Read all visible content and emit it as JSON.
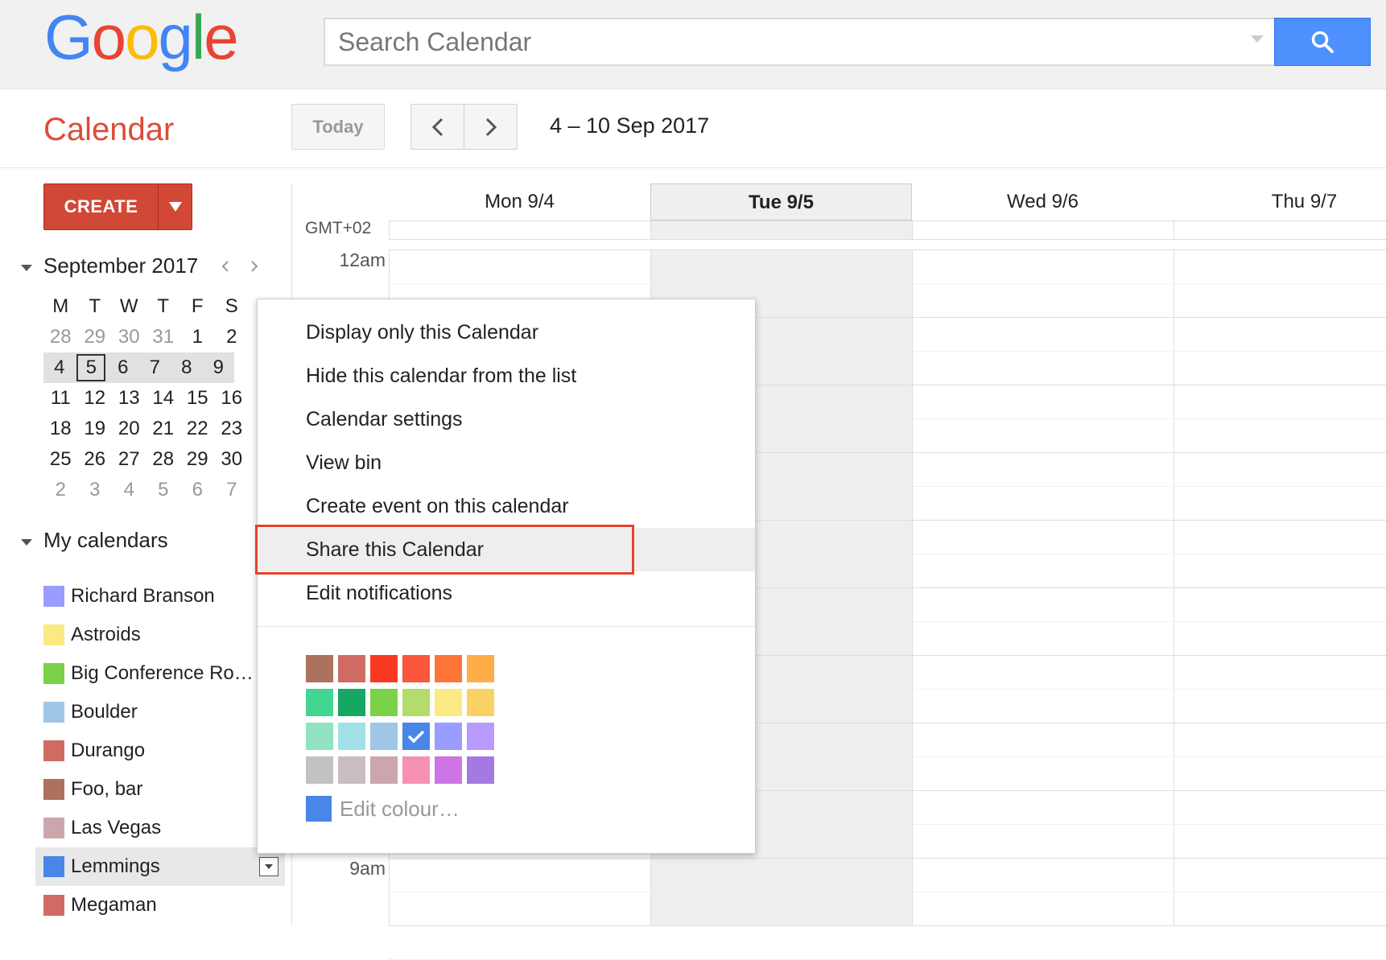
{
  "header": {
    "logo_letters": [
      {
        "ch": "G",
        "color": "#4285F4"
      },
      {
        "ch": "o",
        "color": "#EA4335"
      },
      {
        "ch": "o",
        "color": "#FBBC05"
      },
      {
        "ch": "g",
        "color": "#4285F4"
      },
      {
        "ch": "l",
        "color": "#34A853"
      },
      {
        "ch": "e",
        "color": "#EA4335"
      }
    ],
    "search_placeholder": "Search Calendar",
    "search_icon": "search-icon"
  },
  "toolbar": {
    "app_title": "Calendar",
    "today_label": "Today",
    "prev_icon": "chevron-left-icon",
    "next_icon": "chevron-right-icon",
    "date_range": "4 – 10 Sep 2017"
  },
  "sidebar": {
    "create_label": "CREATE",
    "mini_month": "September 2017",
    "weekday_heads": [
      "M",
      "T",
      "W",
      "T",
      "F",
      "S"
    ],
    "weeks": [
      [
        {
          "d": "28",
          "o": true
        },
        {
          "d": "29",
          "o": true
        },
        {
          "d": "30",
          "o": true
        },
        {
          "d": "31",
          "o": true
        },
        {
          "d": "1"
        },
        {
          "d": "2"
        }
      ],
      [
        {
          "d": "4"
        },
        {
          "d": "5",
          "today": true
        },
        {
          "d": "6"
        },
        {
          "d": "7"
        },
        {
          "d": "8"
        },
        {
          "d": "9"
        }
      ],
      [
        {
          "d": "11"
        },
        {
          "d": "12"
        },
        {
          "d": "13"
        },
        {
          "d": "14"
        },
        {
          "d": "15"
        },
        {
          "d": "16"
        }
      ],
      [
        {
          "d": "18"
        },
        {
          "d": "19"
        },
        {
          "d": "20"
        },
        {
          "d": "21"
        },
        {
          "d": "22"
        },
        {
          "d": "23"
        }
      ],
      [
        {
          "d": "25"
        },
        {
          "d": "26"
        },
        {
          "d": "27"
        },
        {
          "d": "28"
        },
        {
          "d": "29"
        },
        {
          "d": "30"
        }
      ],
      [
        {
          "d": "2",
          "o": true
        },
        {
          "d": "3",
          "o": true
        },
        {
          "d": "4",
          "o": true
        },
        {
          "d": "5",
          "o": true
        },
        {
          "d": "6",
          "o": true
        },
        {
          "d": "7",
          "o": true
        }
      ]
    ],
    "current_week_index": 1,
    "my_calendars_title": "My calendars",
    "calendars": [
      {
        "name": "Richard Branson",
        "color": "#9a9cff"
      },
      {
        "name": "Astroids",
        "color": "#fbe983"
      },
      {
        "name": "Big Conference Roo…",
        "color": "#7bd148"
      },
      {
        "name": "Boulder",
        "color": "#9fc6e7"
      },
      {
        "name": "Durango",
        "color": "#d06b64"
      },
      {
        "name": "Foo, bar",
        "color": "#ac725e"
      },
      {
        "name": "Las Vegas",
        "color": "#cca6ac"
      },
      {
        "name": "Lemmings",
        "color": "#4986e7",
        "active": true
      },
      {
        "name": "Megaman",
        "color": "#d06b64"
      }
    ]
  },
  "grid": {
    "timezone": "GMT+02",
    "days": [
      {
        "label": "Mon 9/4"
      },
      {
        "label": "Tue 9/5",
        "today": true
      },
      {
        "label": "Wed 9/6"
      },
      {
        "label": "Thu 9/7"
      }
    ],
    "time_labels": [
      {
        "label": "12am",
        "hour": 0
      },
      {
        "label": "9am",
        "hour": 9
      }
    ]
  },
  "context_menu": {
    "items": [
      "Display only this Calendar",
      "Hide this calendar from the list",
      "Calendar settings",
      "View bin",
      "Create event on this calendar",
      "Share this Calendar",
      "Edit notifications"
    ],
    "highlighted_index": 5,
    "palette": [
      [
        "#ac725e",
        "#d06b64",
        "#f83a22",
        "#fa573c",
        "#ff7537",
        "#ffad46"
      ],
      [
        "#42d692",
        "#16a765",
        "#7bd148",
        "#b3dc6c",
        "#fbe983",
        "#fad165"
      ],
      [
        "#92e1c0",
        "#9fe1e7",
        "#9fc6e7",
        "#4986e7",
        "#9a9cff",
        "#b99aff"
      ],
      [
        "#c2c2c2",
        "#cabdbf",
        "#cca6ac",
        "#f691b2",
        "#cd74e6",
        "#a47ae2"
      ]
    ],
    "selected_color": "#4986e7",
    "edit_colour_label": "Edit colour…"
  }
}
